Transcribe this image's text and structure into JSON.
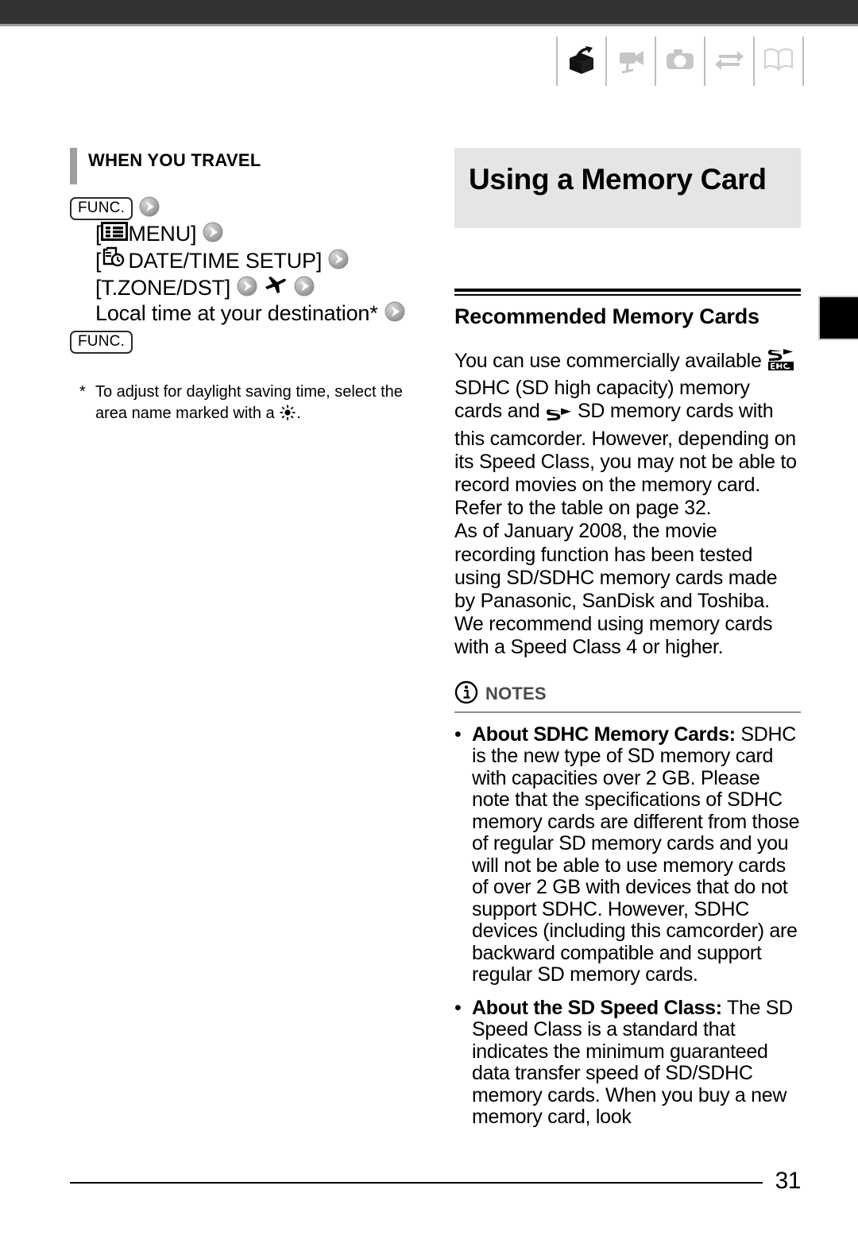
{
  "header": {
    "icons": [
      {
        "name": "box-open-arrow-icon",
        "label": "Getting Started"
      },
      {
        "name": "camcorder-icon",
        "label": "Video"
      },
      {
        "name": "photo-camera-icon",
        "label": "Photos"
      },
      {
        "name": "transfer-arrows-icon",
        "label": "External Connections"
      },
      {
        "name": "open-book-icon",
        "label": "Additional Information"
      }
    ]
  },
  "left_column": {
    "section_heading": {
      "first_letters": "W",
      "rest_1": "HEN YOU TRAVEL",
      "full": "WHEN YOU TRAVEL"
    },
    "steps": [
      {
        "type": "func",
        "label": "FUNC.",
        "arrow": true
      },
      {
        "type": "menu",
        "bracket_open": "[",
        "icon": "menu-list-icon",
        "label": " MENU]",
        "arrow": true
      },
      {
        "type": "datetime",
        "bracket_open": "[",
        "icon": "date-time-icon",
        "label": " DATE/TIME SETUP]",
        "arrow": true
      },
      {
        "type": "tzone",
        "label": "[T.ZONE/DST]",
        "arrow": true,
        "icon": "airplane-icon",
        "arrow2": true
      },
      {
        "type": "local",
        "label": "Local time at your destination*",
        "arrow": true
      },
      {
        "type": "func",
        "label": "FUNC.",
        "arrow": false
      }
    ],
    "footnote": {
      "mark": "*",
      "text_before": "To adjust for daylight saving time, select the area name marked with a",
      "icon": "daylight-saving-sun-icon",
      "text_after": "."
    }
  },
  "right_column": {
    "title": "Using a Memory Card",
    "subhead": "Recommended Memory Cards",
    "paragraph_1": {
      "lead": "You can use commercially available",
      "sdhc_logo": "sdhc-logo",
      "mid": "SDHC (SD high capacity) memory cards and",
      "sd_logo": "sd-logo",
      "tail": "SD memory cards with this camcorder. However, depending on its Speed Class, you may not be able to record movies on the memory card. Refer to the table on page 32."
    },
    "paragraph_2": "As of January 2008, the movie recording function has been tested using SD/SDHC memory cards made by Panasonic, SanDisk and Toshiba. We recommend using memory cards with a Speed Class 4 or higher.",
    "notes": {
      "icon": "info-circle-icon",
      "label": "NOTES",
      "items": [
        {
          "bullet": "•",
          "bold": "About SDHC Memory Cards:",
          "text": " SDHC is the new type of SD memory card with capacities over 2 GB. Please note that the specifications of SDHC memory cards are different from those of regular SD memory cards and you will not be able to use memory cards of over 2 GB with devices that do not support SDHC. However, SDHC devices (including this camcorder) are backward compatible and support regular SD memory cards."
        },
        {
          "bullet": "•",
          "bold": "About the SD Speed Class:",
          "text": " The SD Speed Class is a standard that indicates the minimum guaranteed data transfer speed of SD/SDHC memory cards. When you buy a new memory card, look"
        }
      ]
    }
  },
  "footer": {
    "page_number": "31"
  },
  "colors": {
    "top_bar": "#333333",
    "title_block": "#e5e5e5",
    "accent_bar": "#9e9e9e",
    "notes_label": "#4a4a4a",
    "icon_active": "#1a1a1a",
    "icon_inactive": "#c6c6c6"
  }
}
